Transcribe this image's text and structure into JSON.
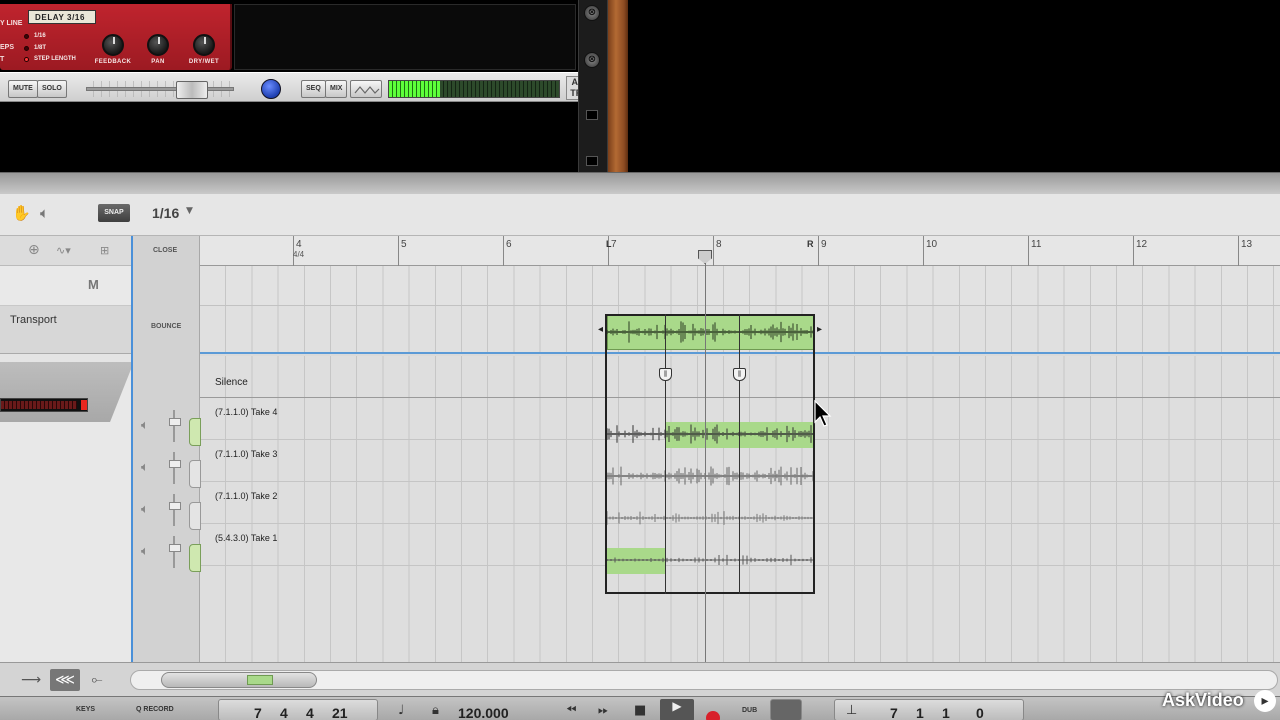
{
  "rack": {
    "delay": {
      "name": "DELAY 3/16",
      "left_label_1": "Y LINE",
      "left_label_2": "EPS",
      "left_label_3": "T",
      "options": [
        "1/16",
        "1/8T",
        "STEP LENGTH"
      ],
      "knobs": [
        "FEEDBACK",
        "PAN",
        "DRY/WET"
      ]
    },
    "mixer": {
      "mute": "MUTE",
      "solo": "SOLO",
      "seq": "SEQ",
      "mix": "MIX",
      "meter_level": 0.3,
      "audio_track_line1": "AUDIO",
      "audio_track_line2": "TRACK"
    }
  },
  "toolbar": {
    "snap_label": "SNAP",
    "snap_value": "1/16"
  },
  "track_list": {
    "m_label": "M",
    "transport_label": "Transport"
  },
  "sequencer": {
    "close_label": "CLOSE",
    "bounce_label": "BOUNCE",
    "time_signature": "4/4",
    "bars": [
      "4",
      "5",
      "6",
      "7",
      "8",
      "9",
      "10",
      "11",
      "12",
      "13"
    ],
    "loop_left": "L",
    "loop_right": "R",
    "silence_label": "Silence",
    "takes": [
      {
        "label": "(7.1.1.0) Take 4",
        "active": true
      },
      {
        "label": "(7.1.1.0) Take 3",
        "active": false
      },
      {
        "label": "(7.1.1.0) Take 2",
        "active": false
      },
      {
        "label": "(5.4.3.0) Take 1",
        "active": true
      }
    ]
  },
  "transport": {
    "keys_label": "KEYS",
    "q_record_label": "Q RECORD",
    "position": [
      "7",
      "4",
      "4",
      "21"
    ],
    "tempo": "120.000",
    "dub_label": "DUB",
    "end_position": [
      "7",
      "1",
      "1",
      "0"
    ]
  },
  "watermark": "AskVideo"
}
